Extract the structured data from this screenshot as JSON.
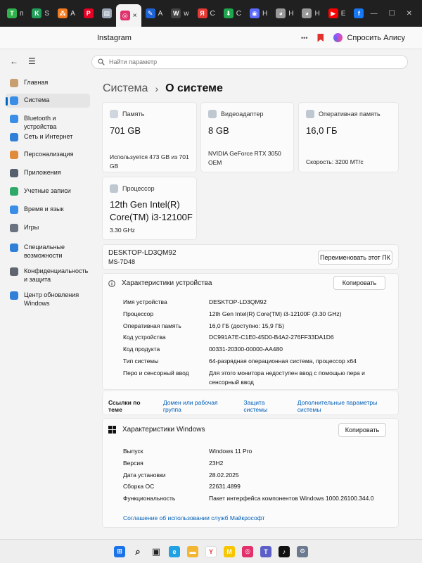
{
  "browser": {
    "tabs": [
      {
        "label": "п",
        "icon": "tinkoff-icon",
        "color": "#2fb24c",
        "glyph": "T"
      },
      {
        "label": "S",
        "icon": "kinopoisk-icon",
        "color": "#22a05a",
        "glyph": "K"
      },
      {
        "label": "A",
        "icon": "dots-icon",
        "color": "#f47b20",
        "glyph": "⁂"
      },
      {
        "label": "",
        "icon": "pinterest-icon",
        "color": "#e60023",
        "glyph": "P"
      },
      {
        "label": "",
        "icon": "page-icon",
        "color": "#9aa5b5",
        "glyph": "▤"
      },
      {
        "label": "×",
        "icon": "instagram-icon",
        "color": "#e1306c",
        "glyph": "◎",
        "active": true
      },
      {
        "label": "A",
        "icon": "pencil-icon",
        "color": "#1e63d6",
        "glyph": "✎"
      },
      {
        "label": "w",
        "icon": "w-icon",
        "color": "#444444",
        "glyph": "W"
      },
      {
        "label": "С",
        "icon": "yandex-icon",
        "color": "#e53935",
        "glyph": "Я"
      },
      {
        "label": "С",
        "icon": "download-icon",
        "color": "#1fa74d",
        "glyph": "⬇"
      },
      {
        "label": "Н",
        "icon": "app-icon",
        "color": "#5b6bff",
        "glyph": "◉"
      },
      {
        "label": "Н",
        "icon": "game-icon",
        "color": "#999999",
        "glyph": "◕"
      },
      {
        "label": "Н",
        "icon": "game2-icon",
        "color": "#999999",
        "glyph": "◕"
      },
      {
        "label": "Е",
        "icon": "youtube-icon",
        "color": "#ff0000",
        "glyph": "▶"
      },
      {
        "label": "",
        "icon": "facebook-icon",
        "color": "#1877f2",
        "glyph": "f"
      }
    ],
    "window_controls": [
      "—",
      "☐",
      "✕"
    ],
    "site_title": "Instagram",
    "menu_dots": "•••",
    "alice_label": "Спросить Алису"
  },
  "settings": {
    "nav_top": {
      "back": "←",
      "menu": "☰"
    },
    "search_placeholder": "Найти параметр",
    "nav": [
      {
        "label": "Главная",
        "icon": "home-icon",
        "color": "#c8a070"
      },
      {
        "label": "Система",
        "icon": "system-icon",
        "color": "#3a8ee6",
        "selected": true
      },
      {
        "label": "Bluetooth и устройства",
        "icon": "bluetooth-icon",
        "color": "#3a8ee6"
      },
      {
        "label": "Сеть и Интернет",
        "icon": "network-icon",
        "color": "#2f80d6"
      },
      {
        "label": "Персонализация",
        "icon": "brush-icon",
        "color": "#e08a3c"
      },
      {
        "label": "Приложения",
        "icon": "apps-icon",
        "color": "#555f6d"
      },
      {
        "label": "Учетные записи",
        "icon": "user-icon",
        "color": "#2fa86a"
      },
      {
        "label": "Время и язык",
        "icon": "globe-icon",
        "color": "#3a8ee6"
      },
      {
        "label": "Игры",
        "icon": "gamepad-icon",
        "color": "#6b7380"
      },
      {
        "label": "Специальные возможности",
        "icon": "accessibility-icon",
        "color": "#2f80d6"
      },
      {
        "label": "Конфиденциальность и защита",
        "icon": "shield-icon",
        "color": "#5f6670"
      },
      {
        "label": "Центр обновления Windows",
        "icon": "update-icon",
        "color": "#2f80d6"
      }
    ],
    "breadcrumb": {
      "parent": "Система",
      "sep": "›",
      "current": "О системе"
    },
    "cards": {
      "storage": {
        "caption": "Память",
        "value": "701 GB",
        "detail": "Используется 473 GB из 701 GB"
      },
      "gpu": {
        "caption": "Видеоадаптер",
        "value": "8 GB",
        "detail1": "NVIDIA GeForce RTX 3050",
        "detail2": "OEM"
      },
      "ram": {
        "caption": "Оперативная память",
        "value": "16,0 ГБ",
        "detail": "Скорость: 3200 МТ/с"
      },
      "cpu": {
        "caption": "Процессор",
        "value1": "12th Gen Intel(R)",
        "value2": "Core(TM) i3-12100F",
        "detail": "3.30 GHz"
      }
    },
    "device": {
      "name": "DESKTOP-LD3QM92",
      "model": "MS-7D48",
      "rename_button": "Переименовать этот ПК"
    },
    "device_specs": {
      "title": "Характеристики устройства",
      "copy_button": "Копировать",
      "rows": [
        {
          "k": "Имя устройства",
          "v": "DESKTOP-LD3QM92"
        },
        {
          "k": "Процессор",
          "v": "12th Gen Intel(R) Core(TM) i3-12100F (3.30 GHz)"
        },
        {
          "k": "Оперативная память",
          "v": "16,0 ГБ (доступно: 15,9 ГБ)"
        },
        {
          "k": "Код устройства",
          "v": "DC991A7E-C1E0-45D0-B4A2-276FF33DA1D6"
        },
        {
          "k": "Код продукта",
          "v": "00331-20300-00000-AA480"
        },
        {
          "k": "Тип системы",
          "v": "64-разрядная операционная система, процессор x64"
        },
        {
          "k": "Перо и сенсорный ввод",
          "v": "Для этого монитора недоступен ввод с помощью пера и сенсорный ввод"
        }
      ]
    },
    "related_links": {
      "label": "Ссылки по теме",
      "links": [
        "Домен или рабочая группа",
        "Защита системы",
        "Дополнительные параметры системы"
      ]
    },
    "windows_specs": {
      "title": "Характеристики Windows",
      "copy_button": "Копировать",
      "rows": [
        {
          "k": "Выпуск",
          "v": "Windows 11 Pro"
        },
        {
          "k": "Версия",
          "v": "23H2"
        },
        {
          "k": "Дата установки",
          "v": "28.02.2025"
        },
        {
          "k": "Сборка ОС",
          "v": "22631.4899"
        },
        {
          "k": "Функциональность",
          "v": "Пакет интерфейса компонентов Windows 1000.26100.344.0"
        }
      ],
      "link": "Соглашение об использовании служб Майкрософт"
    }
  },
  "taskbar": [
    {
      "icon": "windows-start-icon",
      "color": "#1a73e8",
      "glyph": "⊞"
    },
    {
      "icon": "search-icon",
      "color": "#333333",
      "glyph": "⌕"
    },
    {
      "icon": "task-view-icon",
      "color": "#333333",
      "glyph": "▣"
    },
    {
      "icon": "edge-icon",
      "color": "#1fa1e3",
      "glyph": "e"
    },
    {
      "icon": "explorer-icon",
      "color": "#f2b632",
      "glyph": "▬"
    },
    {
      "icon": "yandex-browser-icon",
      "color": "#ffffff",
      "glyph": "Y"
    },
    {
      "icon": "miro-icon",
      "color": "#f7c600",
      "glyph": "M"
    },
    {
      "icon": "instagram-app-icon",
      "color": "#e1306c",
      "glyph": "◎"
    },
    {
      "icon": "teams-icon",
      "color": "#5b5fc7",
      "glyph": "T"
    },
    {
      "icon": "tiktok-icon",
      "color": "#111111",
      "glyph": "♪"
    },
    {
      "icon": "settings-icon",
      "color": "#6b7a8f",
      "glyph": "⚙"
    }
  ]
}
